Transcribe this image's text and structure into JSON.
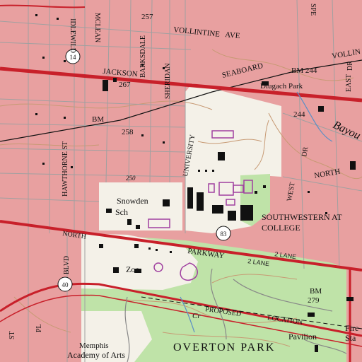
{
  "colors": {
    "urban": "#e8a0a0",
    "park": "#bfe3a8",
    "campus": "#f4f1e8",
    "highway": "#c8202a",
    "street": "#a0a0a0",
    "contour": "#c79a74",
    "water": "#5b8fc6",
    "purple": "#a040a0",
    "building": "#111111"
  },
  "labels": {
    "jackson": "JACKSON",
    "vollintine": "VOLLINTINE",
    "ave": "AVE",
    "seaboard": "SEABOARD",
    "vollin_right": "VOLLIN",
    "bm244": "BM 244",
    "num244": "244",
    "dlugach_park": "Dlugach Park",
    "bayou": "Bayou",
    "north": "NORTH",
    "east": "EAST",
    "dr": "DR",
    "dr2": "DR",
    "west": "WEST",
    "idlewild": "IDLEWILD",
    "mclean": "MCLEAN",
    "barksdale": "BARKSDALE",
    "sheridan": "SHERIDAN",
    "university": "UNIVERSITY",
    "num257": "257",
    "num267": "267",
    "bm_left": "BM",
    "num258": "258",
    "num250": "250",
    "hawthorne_st": "HAWTHORNE ST",
    "snowden": "Snowden",
    "sch": "Sch",
    "southwestern": "SOUTHWESTERN AT",
    "college": "COLLEGE",
    "north_parkway_north": "NORTH",
    "parkway": "PARKWAY",
    "two_lane_1": "2 LANE",
    "two_lane_2": "2 LANE",
    "blvd": "BLVD",
    "zoo": "Zoo",
    "route14": "14",
    "route40": "40",
    "route83": "83",
    "bm279": "BM",
    "num279": "279",
    "proposed": "PROPOSED",
    "location": "LOCATION",
    "pavilion": "Pavilion",
    "fire": "Fire",
    "sta": "Sta",
    "memphis": "Memphis",
    "academy": "Academy of Arts",
    "overton_park": "OVERTON PARK",
    "cr": "Cr",
    "pl": "PL",
    "st_right": "ST",
    "spe": "SPE"
  }
}
